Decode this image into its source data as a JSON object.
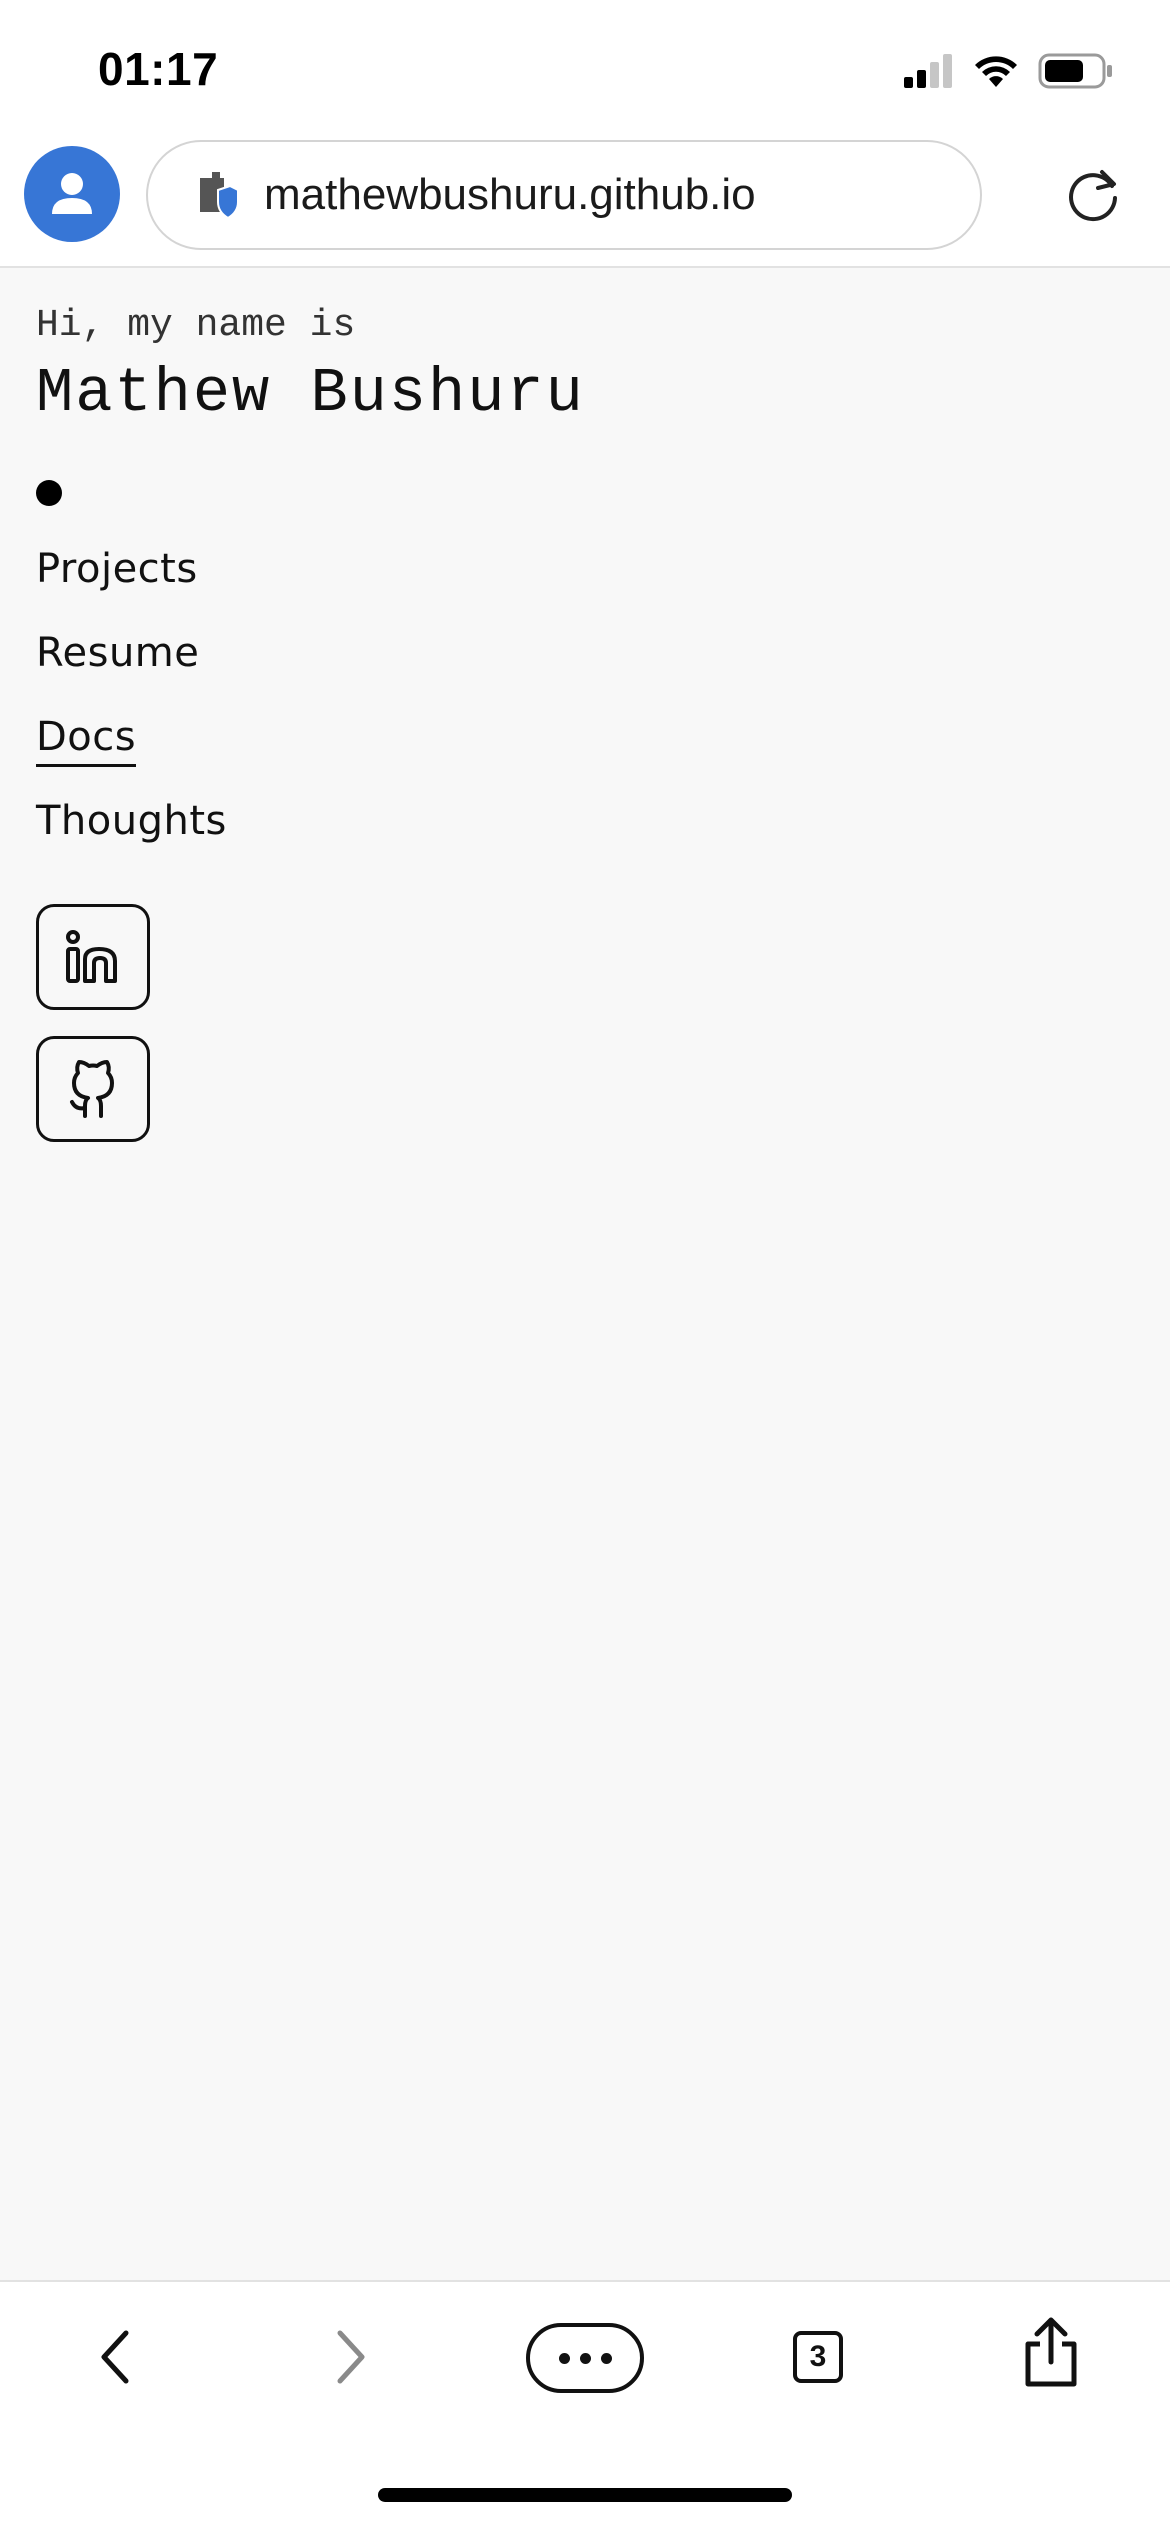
{
  "status_bar": {
    "time": "01:17"
  },
  "browser": {
    "url": "mathewbushuru.github.io",
    "tab_count": "3",
    "accent_color": "#3776d6"
  },
  "page": {
    "greeting": "Hi, my name is",
    "name": "Mathew Bushuru",
    "nav": [
      {
        "label": "Projects",
        "active": false
      },
      {
        "label": "Resume",
        "active": false
      },
      {
        "label": "Docs",
        "active": true
      },
      {
        "label": "Thoughts",
        "active": false
      }
    ],
    "social": [
      {
        "icon": "linkedin-icon"
      },
      {
        "icon": "github-icon"
      }
    ]
  },
  "toolbar": {
    "icons": [
      "back-icon",
      "forward-icon",
      "more-icon",
      "tabs-icon",
      "share-icon"
    ]
  }
}
